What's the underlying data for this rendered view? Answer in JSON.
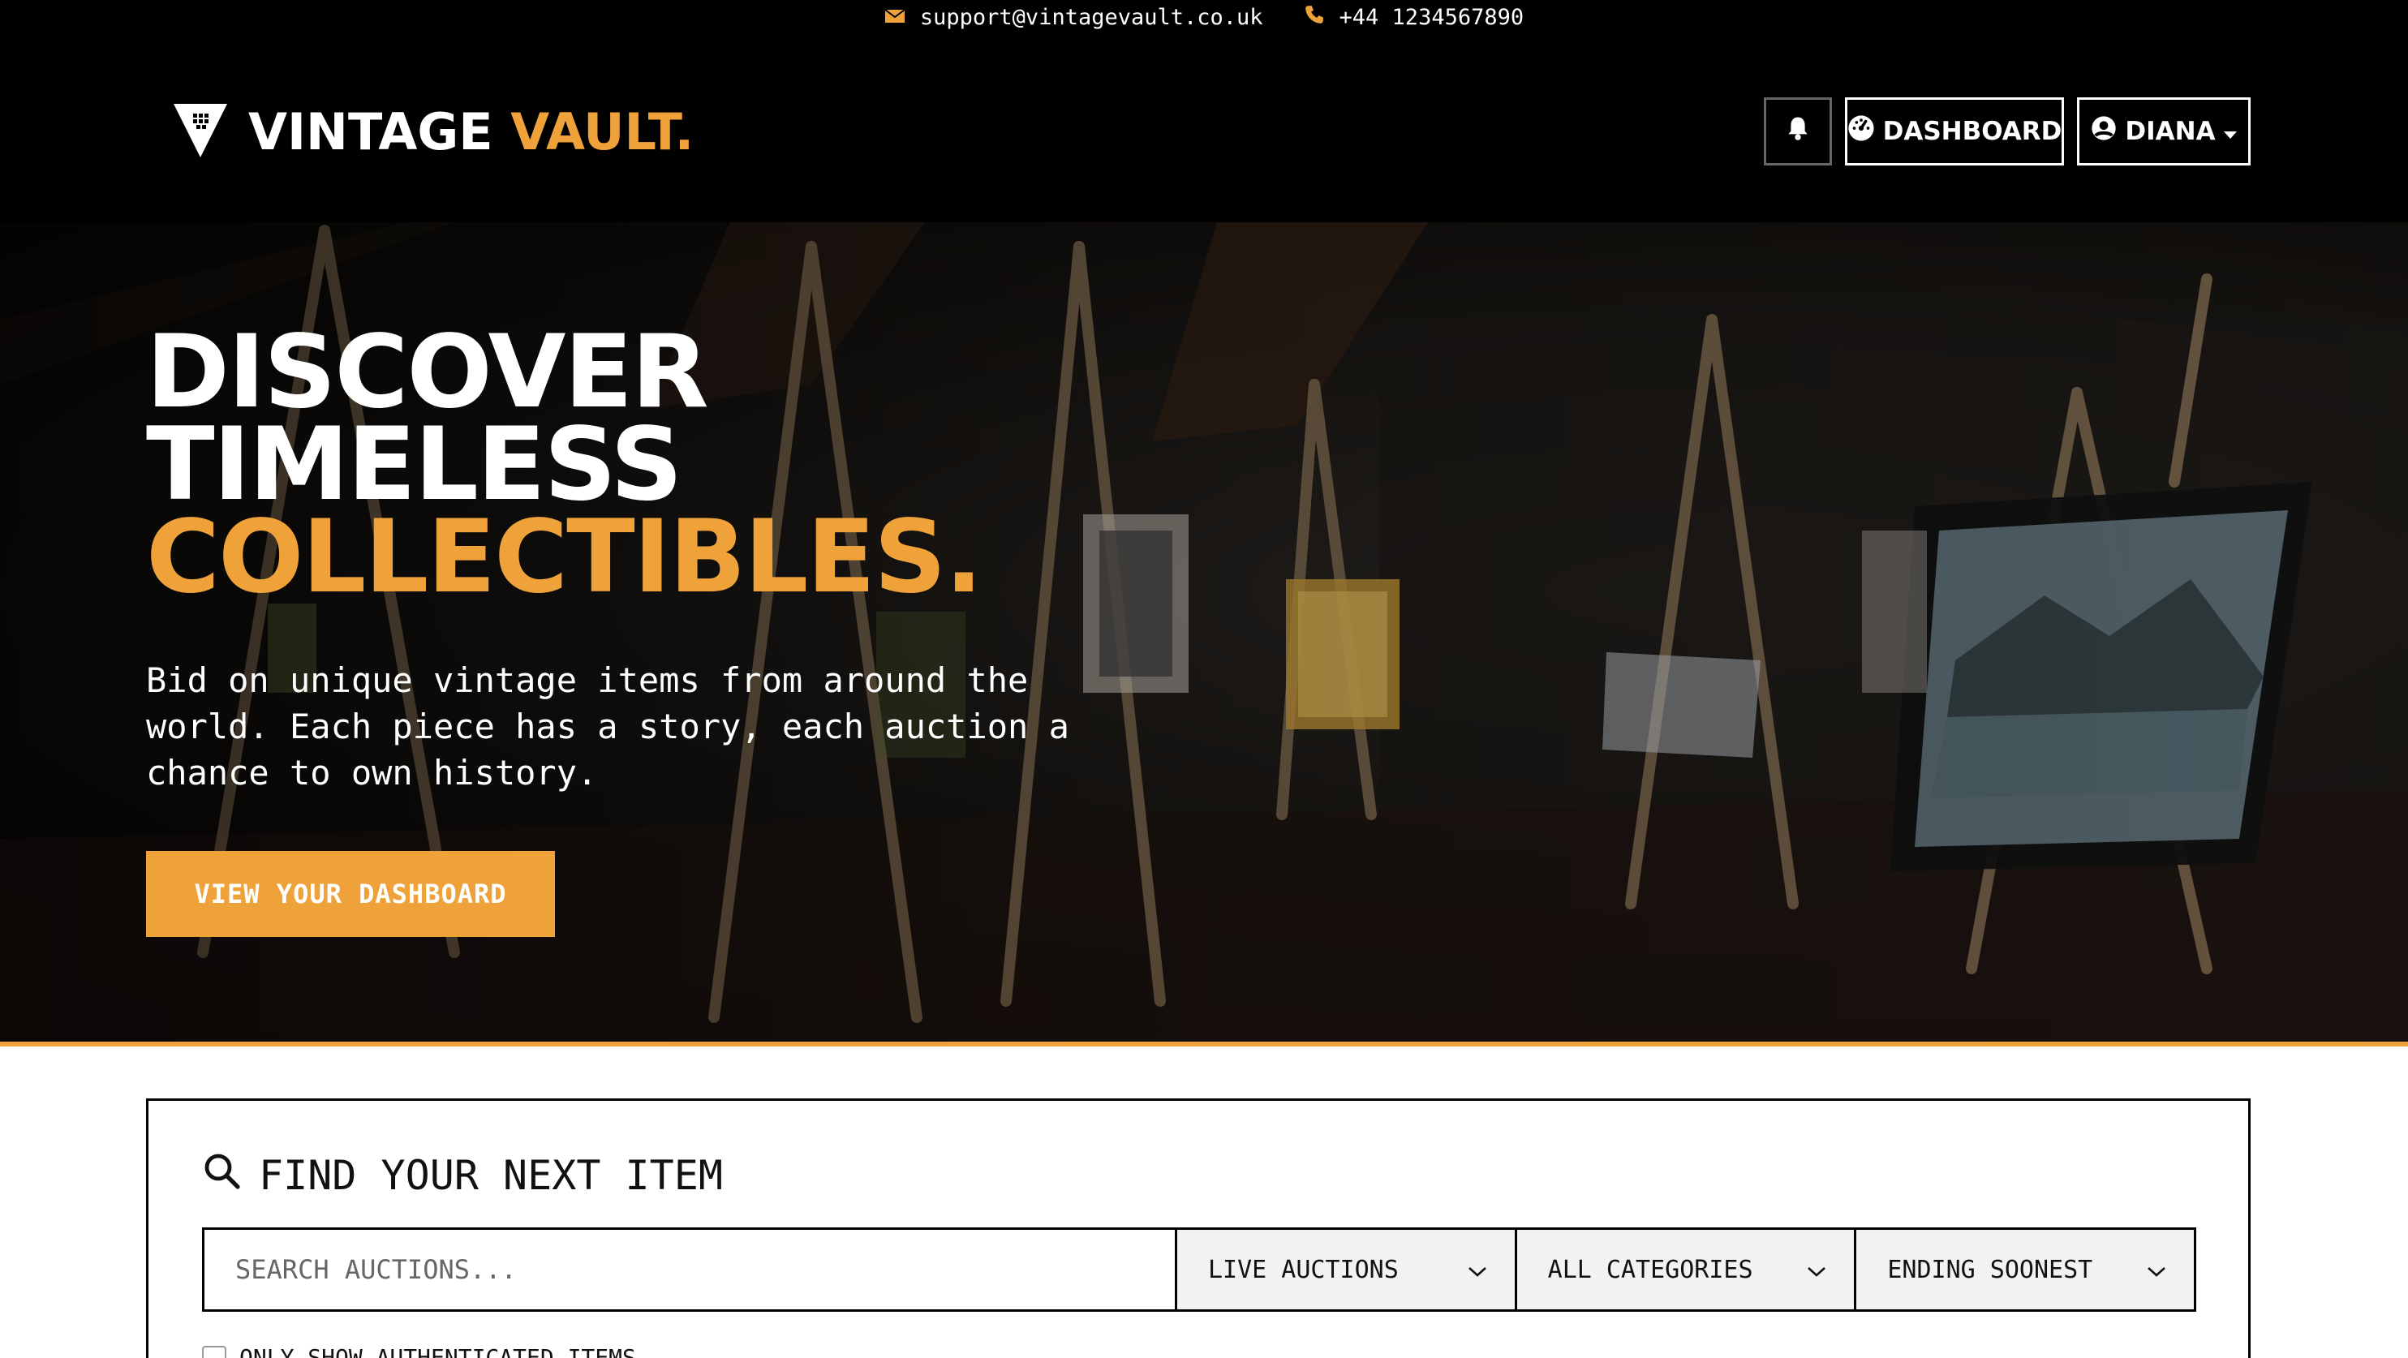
{
  "topbar": {
    "email_icon": "envelope-icon",
    "email": "support@vintagevault.co.uk",
    "phone_icon": "phone-icon",
    "phone": "+44 1234567890"
  },
  "header": {
    "logo_icon": "vault-shield-icon",
    "logo_word1": "VINTAGE",
    "logo_word2": "VAULT.",
    "notifications_icon": "bell-icon",
    "dashboard_icon": "gauge-icon",
    "dashboard_label": "DASHBOARD",
    "user_icon": "user-circle-icon",
    "user_label": "DIANA",
    "user_caret_icon": "caret-down-icon"
  },
  "hero": {
    "headline_line1": "DISCOVER",
    "headline_line2": "TIMELESS",
    "headline_line3": "COLLECTIBLES.",
    "lede": "Bid on unique vintage items from around the world. Each piece has a story, each auction a chance to own history.",
    "cta_label": "VIEW YOUR DASHBOARD"
  },
  "search": {
    "title_icon": "search-icon",
    "title": "FIND YOUR NEXT ITEM",
    "placeholder": "SEARCH AUCTIONS...",
    "status_value": "LIVE AUCTIONS",
    "category_value": "ALL CATEGORIES",
    "sort_value": "ENDING SOONEST",
    "authenticated_label": "ONLY SHOW AUTHENTICATED ITEMS"
  },
  "colors": {
    "accent": "#f0a23a",
    "background_dark": "#000000",
    "text_light": "#ffffff"
  }
}
